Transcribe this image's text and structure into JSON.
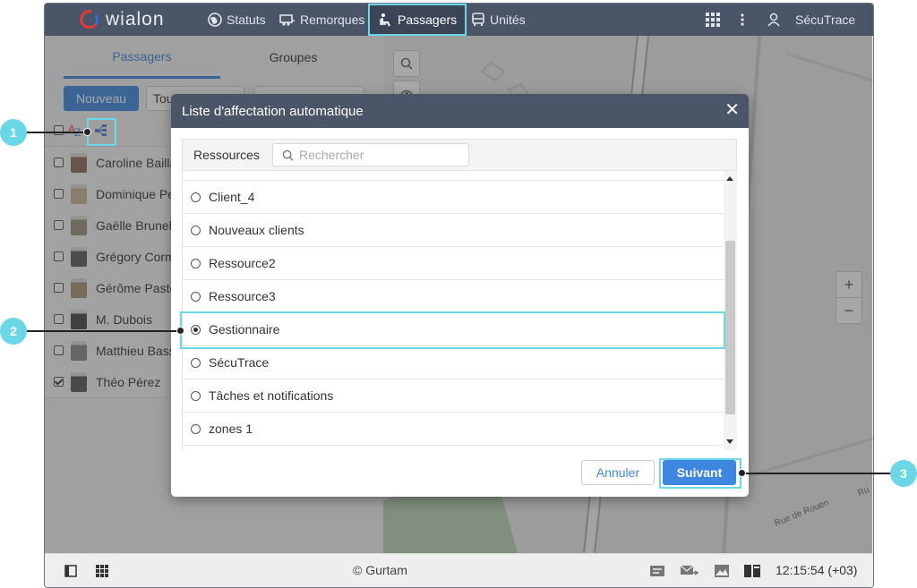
{
  "app": {
    "logo_text": "wialon",
    "user": "SécuTrace"
  },
  "nav": {
    "items": [
      {
        "label": "Statuts",
        "icon": "globe-icon"
      },
      {
        "label": "Remorques",
        "icon": "trailer-icon"
      },
      {
        "label": "Passagers",
        "icon": "passenger-icon"
      },
      {
        "label": "Unités",
        "icon": "bus-icon"
      }
    ]
  },
  "left": {
    "tabs": [
      "Passagers",
      "Groupes"
    ],
    "new_button": "Nouveau",
    "filter_partial": "Tou",
    "rows": [
      {
        "name": "Caroline Bailla",
        "checked": false
      },
      {
        "name": "Dominique Pe",
        "checked": false
      },
      {
        "name": "Gaëlle Brunell",
        "checked": false
      },
      {
        "name": "Grégory Corm",
        "checked": false
      },
      {
        "name": "Gérôme Paste",
        "checked": false
      },
      {
        "name": "M. Dubois",
        "checked": false
      },
      {
        "name": "Matthieu Bass",
        "checked": false
      },
      {
        "name": "Théo Pérez",
        "checked": true
      }
    ]
  },
  "map": {
    "street": "Rue de Rouen",
    "street_partial": "Ru"
  },
  "dialog": {
    "title": "Liste d'affectation automatique",
    "resources_label": "Ressources",
    "search_placeholder": "Rechercher",
    "items": [
      {
        "label": "Client_4",
        "selected": false
      },
      {
        "label": "Nouveaux clients",
        "selected": false
      },
      {
        "label": "Ressource2",
        "selected": false
      },
      {
        "label": "Ressource3",
        "selected": false
      },
      {
        "label": "Gestionnaire",
        "selected": true
      },
      {
        "label": "SécuTrace",
        "selected": false
      },
      {
        "label": "Tâches et notifications",
        "selected": false
      },
      {
        "label": "zones 1",
        "selected": false
      }
    ],
    "cancel": "Annuler",
    "next": "Suivant"
  },
  "footer": {
    "copyright": "© Gurtam",
    "time": "12:15:54 (+03)"
  },
  "callouts": [
    "1",
    "2",
    "3"
  ],
  "colors": {
    "accent": "#3d87e0",
    "highlight": "#6cd8e8",
    "topbar": "#4a5568"
  }
}
